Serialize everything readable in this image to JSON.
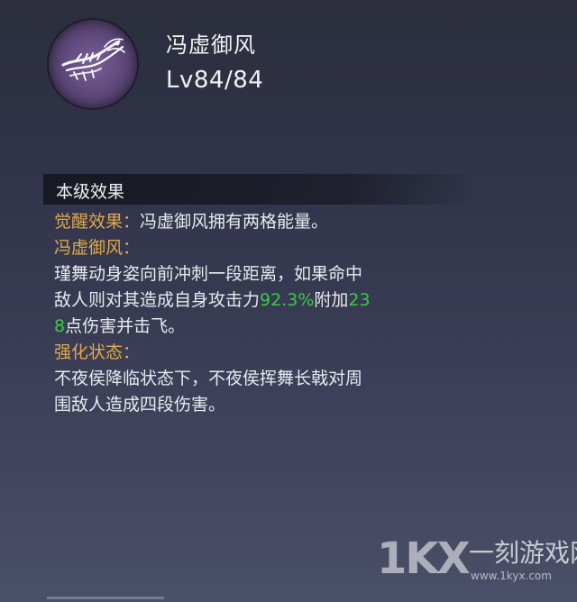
{
  "skill": {
    "name": "冯虚御风",
    "level": "Lv84/84",
    "icon": "wind-dragon-skill-icon"
  },
  "section": {
    "title": "本级效果"
  },
  "effects": {
    "awaken_label": "觉醒效果：",
    "awaken_text": "冯虚御风拥有两格能量。",
    "skill_label": "冯虚御风：",
    "skill_line1": "瑾舞动身姿向前冲刺一段距离，如果命中",
    "skill_line2_prefix": "敌人则对其造成自身攻击力",
    "skill_percent": "92.3%",
    "skill_line2_mid": "附加",
    "skill_value_part1": "23",
    "skill_value_part2": "8",
    "skill_line3_suffix": "点伤害并击飞。",
    "enhanced_label": "强化状态：",
    "enhanced_line1": "不夜侯降临状态下，不夜侯挥舞长戟对周",
    "enhanced_line2": "围敌人造成四段伤害。"
  },
  "colors": {
    "label_orange": "#e0a94a",
    "value_green": "#3ec941",
    "text": "#e8eaee",
    "icon_purple": "#7a5f98"
  },
  "watermark": {
    "logo": "1KX",
    "name": "一刻游戏网",
    "url": "www.1kyx.com"
  }
}
